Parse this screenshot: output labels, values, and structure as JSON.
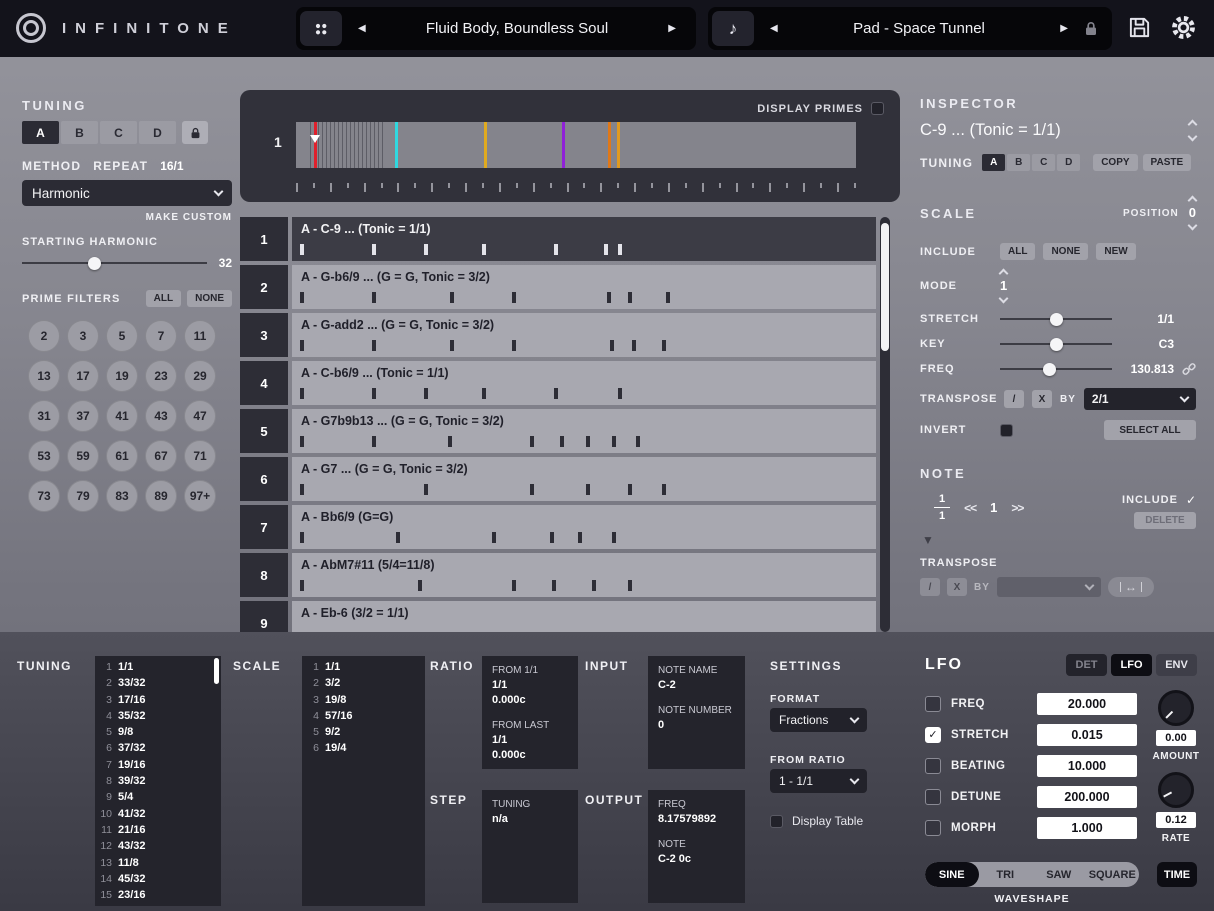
{
  "icons": {
    "prev": "◀",
    "next": "▶",
    "note": "♪",
    "check": "✓",
    "marker_down": "▼",
    "swap": "↔"
  },
  "topbar": {
    "logo": "INFINITONE",
    "preset_patch": "Fluid Body, Boundless Soul",
    "preset_sound": "Pad - Space Tunnel"
  },
  "tuning_panel": {
    "title": "TUNING",
    "tabs": [
      "A",
      "B",
      "C",
      "D"
    ],
    "method_label": "METHOD",
    "repeat_label": "REPEAT",
    "repeat_value": "16/1",
    "method_value": "Harmonic",
    "make_custom_label": "MAKE CUSTOM",
    "starting_harmonic_label": "STARTING HARMONIC",
    "starting_harmonic_value": "32",
    "prime_filters_label": "PRIME FILTERS",
    "all_label": "ALL",
    "none_label": "NONE",
    "primes": [
      "2",
      "3",
      "5",
      "7",
      "11",
      "13",
      "17",
      "19",
      "23",
      "29",
      "31",
      "37",
      "41",
      "43",
      "47",
      "53",
      "59",
      "61",
      "67",
      "71",
      "73",
      "79",
      "83",
      "89",
      "97+"
    ]
  },
  "sequencer": {
    "display_primes_label": "DISPLAY PRIMES",
    "timeline_step": "1",
    "markers": [
      {
        "pos": 3.2,
        "color": "#e0202c",
        "arrow": true
      },
      {
        "pos": 17.7,
        "color": "#30d8e0"
      },
      {
        "pos": 33.6,
        "color": "#e0aa20"
      },
      {
        "pos": 47.5,
        "color": "#9020d8"
      },
      {
        "pos": 55.7,
        "color": "#e07818"
      },
      {
        "pos": 57.4,
        "color": "#e09a20"
      }
    ],
    "rows": [
      {
        "num": "1",
        "label": "A - C-9 ... (Tonic = 1/1)",
        "selected": true,
        "ticks": [
          1.4,
          13.7,
          22.6,
          32.5,
          44.9,
          53.4,
          55.8
        ]
      },
      {
        "num": "2",
        "label": "A - G-b6/9 ...  (G = G, Tonic = 3/2)",
        "selected": false,
        "ticks": [
          1.4,
          13.7,
          27,
          37.7,
          53.9,
          57.5,
          64
        ]
      },
      {
        "num": "3",
        "label": "A - G-add2 ...  (G = G, Tonic = 3/2)",
        "selected": false,
        "ticks": [
          1.4,
          13.7,
          27,
          37.7,
          54.5,
          58.2,
          63.4
        ]
      },
      {
        "num": "4",
        "label": "A - C-b6/9 ... (Tonic = 1/1)",
        "selected": false,
        "ticks": [
          1.4,
          13.7,
          22.6,
          32.5,
          44.9,
          55.8
        ]
      },
      {
        "num": "5",
        "label": "A - G7b9b13 ...  (G = G, Tonic = 3/2)",
        "selected": false,
        "ticks": [
          1.4,
          13.7,
          26.7,
          40.8,
          45.9,
          50.3,
          54.8,
          58.9
        ]
      },
      {
        "num": "6",
        "label": "A - G7 ...  (G = G, Tonic = 3/2)",
        "selected": false,
        "ticks": [
          1.4,
          22.6,
          40.8,
          50.3,
          57.5,
          63.4
        ]
      },
      {
        "num": "7",
        "label": "A - Bb6/9 (G=G)",
        "selected": false,
        "ticks": [
          1.4,
          17.8,
          34.2,
          44.2,
          49,
          54.8
        ]
      },
      {
        "num": "8",
        "label": "A - AbM7#11 (5/4=11/8)",
        "selected": false,
        "ticks": [
          1.4,
          21.6,
          37.7,
          44.5,
          51.4,
          57.5
        ]
      },
      {
        "num": "9",
        "label": "A - Eb-6 (3/2 = 1/1)",
        "selected": false,
        "ticks": []
      }
    ]
  },
  "inspector": {
    "title": "INSPECTOR",
    "selection": "C-9 ... (Tonic = 1/1)",
    "tuning_label": "TUNING",
    "tuning_tabs": [
      "A",
      "B",
      "C",
      "D"
    ],
    "copy_label": "COPY",
    "paste_label": "PASTE",
    "scale": {
      "title": "SCALE",
      "position_label": "POSITION",
      "position_value": "0",
      "include_label": "INCLUDE",
      "all_label": "ALL",
      "none_label": "NONE",
      "new_label": "NEW",
      "mode_label": "MODE",
      "mode_value": "1",
      "stretch_label": "STRETCH",
      "stretch_value": "1/1",
      "key_label": "KEY",
      "key_value": "C3",
      "freq_label": "FREQ",
      "freq_value": "130.813",
      "transpose_label": "TRANSPOSE",
      "divide_label": "/",
      "multiply_label": "X",
      "by_label": "BY",
      "transpose_value": "2/1",
      "invert_label": "INVERT",
      "select_all_label": "SELECT ALL"
    },
    "note": {
      "title": "NOTE",
      "numerator": "1",
      "denominator": "1",
      "prev_label": "<<",
      "index_value": "1",
      "next_label": ">>",
      "include_label": "INCLUDE",
      "delete_label": "DELETE",
      "transpose_label": "TRANSPOSE",
      "divide_label": "/",
      "multiply_label": "X",
      "by_label": "BY"
    }
  },
  "bottom": {
    "tuning_label": "TUNING",
    "tuning_list": [
      {
        "num": "1",
        "value": "1/1"
      },
      {
        "num": "2",
        "value": "33/32"
      },
      {
        "num": "3",
        "value": "17/16"
      },
      {
        "num": "4",
        "value": "35/32"
      },
      {
        "num": "5",
        "value": "9/8"
      },
      {
        "num": "6",
        "value": "37/32"
      },
      {
        "num": "7",
        "value": "19/16"
      },
      {
        "num": "8",
        "value": "39/32"
      },
      {
        "num": "9",
        "value": "5/4"
      },
      {
        "num": "10",
        "value": "41/32"
      },
      {
        "num": "11",
        "value": "21/16"
      },
      {
        "num": "12",
        "value": "43/32"
      },
      {
        "num": "13",
        "value": "11/8"
      },
      {
        "num": "14",
        "value": "45/32"
      },
      {
        "num": "15",
        "value": "23/16"
      }
    ],
    "scale_label": "SCALE",
    "scale_list": [
      {
        "num": "1",
        "value": "1/1"
      },
      {
        "num": "2",
        "value": "3/2"
      },
      {
        "num": "3",
        "value": "19/8"
      },
      {
        "num": "4",
        "value": "57/16"
      },
      {
        "num": "5",
        "value": "9/2"
      },
      {
        "num": "6",
        "value": "19/4"
      }
    ],
    "ratio_label": "RATIO",
    "ratio": {
      "from_first_label": "FROM 1/1",
      "from_first_value": "1/1",
      "from_first_cents": "0.000c",
      "from_last_label": "FROM LAST",
      "from_last_value": "1/1",
      "from_last_cents": "0.000c"
    },
    "step_label": "STEP",
    "step": {
      "tuning_label": "TUNING",
      "tuning_value": "n/a"
    },
    "input_label": "INPUT",
    "input": {
      "note_name_label": "NOTE NAME",
      "note_name_value": "C-2",
      "note_number_label": "NOTE NUMBER",
      "note_number_value": "0"
    },
    "output_label": "OUTPUT",
    "output": {
      "freq_label": "FREQ",
      "freq_value": "8.17579892",
      "note_label": "NOTE",
      "note_value": "C-2 0c"
    },
    "settings": {
      "title": "SETTINGS",
      "format_label": "FORMAT",
      "format_value": "Fractions",
      "from_ratio_label": "FROM RATIO",
      "from_ratio_value": "1 - 1/1",
      "display_table_label": "Display Table"
    },
    "lfo": {
      "title": "LFO",
      "tabs": [
        "DET",
        "LFO",
        "ENV"
      ],
      "active_tab": "LFO",
      "params": [
        {
          "label": "FREQ",
          "value": "20.000",
          "checked": false
        },
        {
          "label": "STRETCH",
          "value": "0.015",
          "checked": true
        },
        {
          "label": "BEATING",
          "value": "10.000",
          "checked": false
        },
        {
          "label": "DETUNE",
          "value": "200.000",
          "checked": false
        },
        {
          "label": "MORPH",
          "value": "1.000",
          "checked": false
        }
      ],
      "amount_value": "0.00",
      "amount_label": "AMOUNT",
      "rate_value": "0.12",
      "rate_label": "RATE",
      "waveshapes": [
        "SINE",
        "TRI",
        "SAW",
        "SQUARE"
      ],
      "active_waveshape": "SINE",
      "time_label": "TIME",
      "waveshape_label": "WAVESHAPE"
    }
  }
}
